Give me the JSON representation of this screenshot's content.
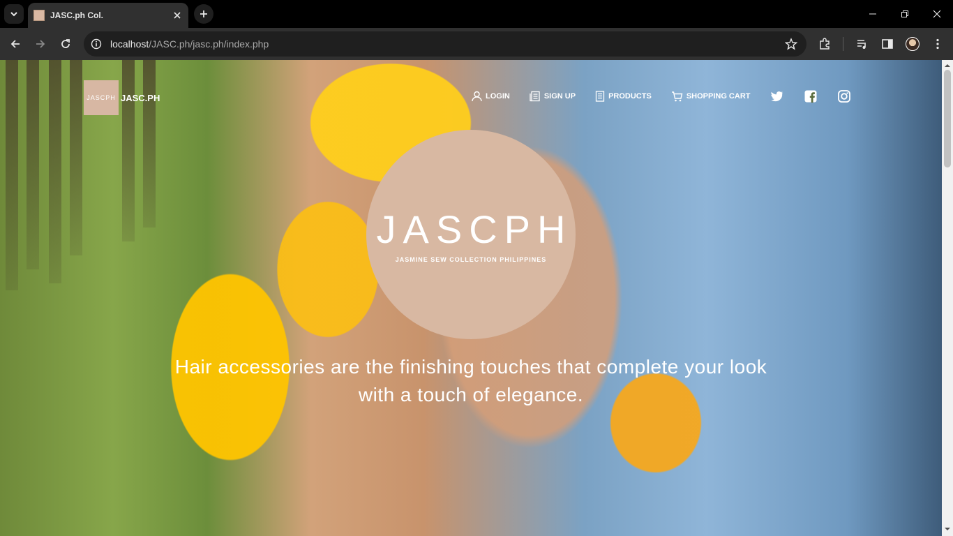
{
  "browser": {
    "tab_title": "JASC.ph Col.",
    "url_host": "localhost",
    "url_path": "/JASC.ph/jasc.ph/index.php"
  },
  "site": {
    "brand_logo_text": "JASCPH",
    "brand_name": "JASC.PH",
    "nav": [
      {
        "label": "LOGIN",
        "icon": "user-icon"
      },
      {
        "label": "SIGN UP",
        "icon": "form-icon"
      },
      {
        "label": "PRODUCTS",
        "icon": "document-icon"
      },
      {
        "label": "SHOPPING CART",
        "icon": "cart-icon"
      }
    ],
    "social": [
      "twitter-icon",
      "facebook-icon",
      "instagram-icon"
    ],
    "hero_title": "JASCPH",
    "hero_subtitle": "JASMINE SEW COLLECTION PHILIPPINES",
    "tagline": "Hair accessories are the finishing touches that complete your look with a touch of elegance.",
    "colors": {
      "circle": "#d8b8a2",
      "chrome_bg": "#000000",
      "toolbar_bg": "#303030"
    }
  }
}
